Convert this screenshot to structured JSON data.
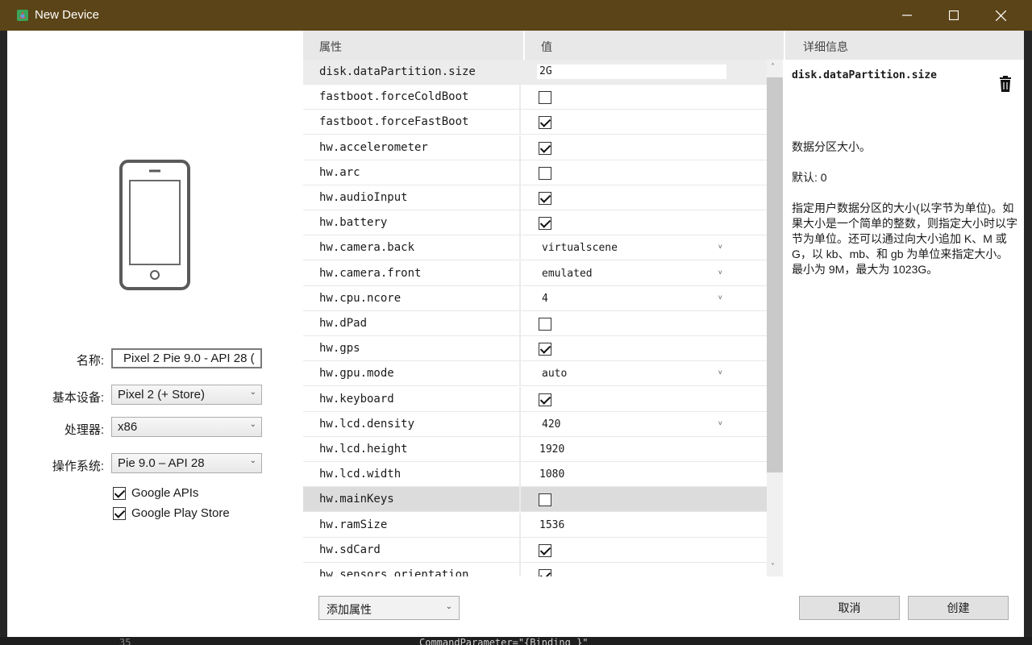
{
  "window": {
    "title": "New Device"
  },
  "background_code": {
    "line_number": "35",
    "code_text": "CommandParameter=\"{Binding  }\""
  },
  "left_pane": {
    "name_label": "名称:",
    "name_value": "Pixel 2 Pie 9.0 - API 28 (",
    "base_device_label": "基本设备:",
    "base_device_value": "Pixel 2 (+ Store)",
    "cpu_label": "处理器:",
    "cpu_value": "x86",
    "os_label": "操作系统:",
    "os_value": "Pie 9.0 – API 28",
    "google_apis_label": "Google APIs",
    "google_apis_checked": true,
    "play_store_label": "Google Play Store",
    "play_store_checked": true
  },
  "grid": {
    "header_property": "属性",
    "header_value": "值",
    "header_details": "详细信息",
    "rows": [
      {
        "name": "disk.dataPartition.size",
        "type": "input",
        "value": "2G",
        "state": "sel"
      },
      {
        "name": "fastboot.forceColdBoot",
        "type": "check",
        "checked": false
      },
      {
        "name": "fastboot.forceFastBoot",
        "type": "check",
        "checked": true
      },
      {
        "name": "hw.accelerometer",
        "type": "check",
        "checked": true
      },
      {
        "name": "hw.arc",
        "type": "check",
        "checked": false
      },
      {
        "name": "hw.audioInput",
        "type": "check",
        "checked": true
      },
      {
        "name": "hw.battery",
        "type": "check",
        "checked": true
      },
      {
        "name": "hw.camera.back",
        "type": "drop",
        "value": "virtualscene"
      },
      {
        "name": "hw.camera.front",
        "type": "drop",
        "value": "emulated"
      },
      {
        "name": "hw.cpu.ncore",
        "type": "drop",
        "value": "4"
      },
      {
        "name": "hw.dPad",
        "type": "check",
        "checked": false
      },
      {
        "name": "hw.gps",
        "type": "check",
        "checked": true
      },
      {
        "name": "hw.gpu.mode",
        "type": "drop",
        "value": "auto"
      },
      {
        "name": "hw.keyboard",
        "type": "check",
        "checked": true
      },
      {
        "name": "hw.lcd.density",
        "type": "drop",
        "value": "420"
      },
      {
        "name": "hw.lcd.height",
        "type": "text",
        "value": "1920"
      },
      {
        "name": "hw.lcd.width",
        "type": "text",
        "value": "1080"
      },
      {
        "name": "hw.mainKeys",
        "type": "check",
        "checked": false,
        "state": "hl"
      },
      {
        "name": "hw.ramSize",
        "type": "text",
        "value": "1536"
      },
      {
        "name": "hw.sdCard",
        "type": "check",
        "checked": true
      },
      {
        "name": "hw.sensors.orientation",
        "type": "check",
        "checked": true
      }
    ]
  },
  "details": {
    "title": "disk.dataPartition.size",
    "summary": "数据分区大小。",
    "default_text": "默认: 0",
    "description": "指定用户数据分区的大小(以字节为单位)。如果大小是一个简单的整数，则指定大小时以字节为单位。还可以通过向大小追加 K、M 或 G，以 kb、mb、和 gb 为单位来指定大小。最小为 9M，最大为 1023G。"
  },
  "footer": {
    "add_property_label": "添加属性",
    "cancel_label": "取消",
    "create_label": "创建"
  },
  "colors": {
    "titlebar": "#5b4417",
    "header_bg": "#e8e8e8",
    "row_highlight": "#dcdcdc"
  }
}
